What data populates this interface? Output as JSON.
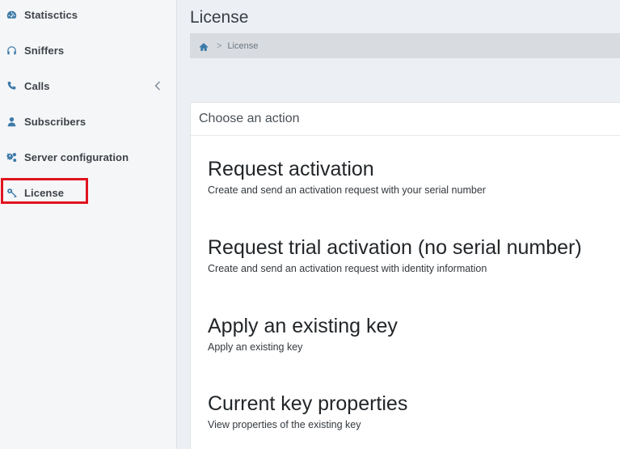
{
  "sidebar": {
    "items": [
      {
        "label": "Statisctics",
        "icon": "dashboard-icon"
      },
      {
        "label": "Sniffers",
        "icon": "headphones-icon"
      },
      {
        "label": "Calls",
        "icon": "phone-icon",
        "has_submenu": true
      },
      {
        "label": "Subscribers",
        "icon": "user-icon"
      },
      {
        "label": "Server configuration",
        "icon": "gears-icon"
      },
      {
        "label": "License",
        "icon": "key-icon",
        "active": true
      }
    ]
  },
  "page": {
    "title": "License",
    "breadcrumb": {
      "home_icon": "home-icon",
      "separator": ">",
      "current": "License"
    }
  },
  "panel": {
    "header": "Choose an action",
    "actions": [
      {
        "title": "Request activation",
        "description": "Create and send an activation request with your serial number"
      },
      {
        "title": "Request trial activation (no serial number)",
        "description": "Create and send an activation request with identity information"
      },
      {
        "title": "Apply an existing key",
        "description": "Apply an existing key"
      },
      {
        "title": "Current key properties",
        "description": "View properties of the existing key"
      }
    ]
  },
  "colors": {
    "accent": "#3c7aa8",
    "highlight": "#e0141e",
    "sidebar_bg": "#f5f6f8",
    "breadcrumb_bg": "#d8dce1"
  }
}
